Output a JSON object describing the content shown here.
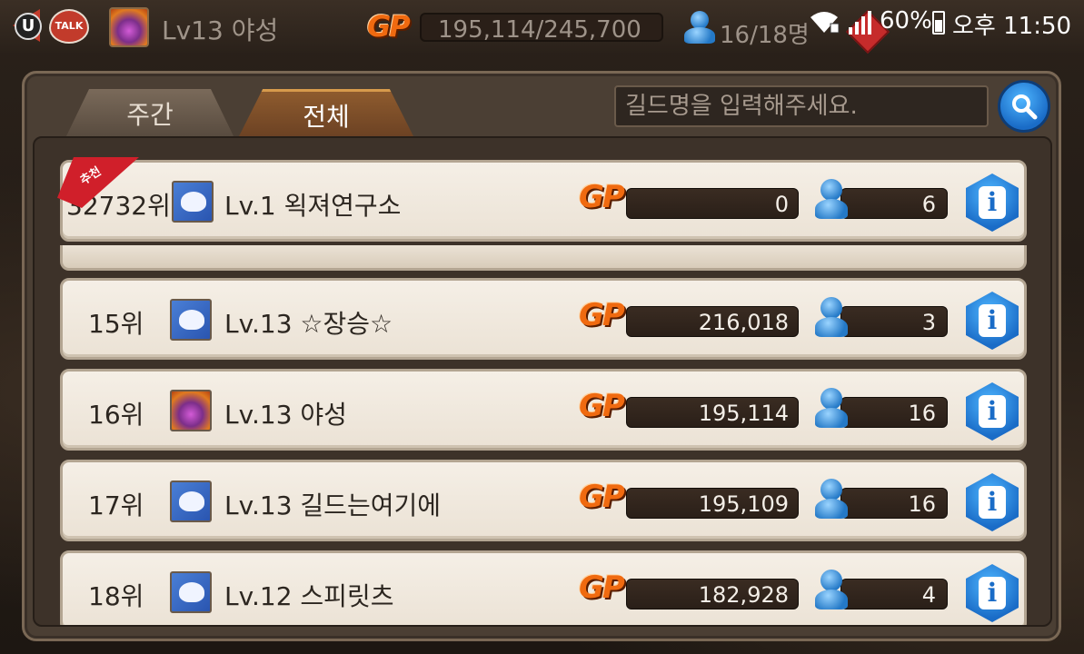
{
  "topbar": {
    "app_icon_label": "U",
    "talk_label": "TALK",
    "guild_title": "Lv13 야성",
    "gp_label": "GP",
    "gp_value": "195,114/245,700",
    "members_value": "16/18명"
  },
  "status_bar": {
    "battery_pct": "60%",
    "time": "오후 11:50"
  },
  "tabs": [
    {
      "label": "주간",
      "active": false
    },
    {
      "label": "전체",
      "active": true
    }
  ],
  "search": {
    "placeholder": "길드명을 입력해주세요."
  },
  "featured_row": {
    "badge": "추천",
    "rank": "32732위",
    "name": "Lv.1   왹져연구소",
    "gp_label": "GP",
    "gp": "0",
    "members": "6",
    "info_label": "i"
  },
  "rows": [
    {
      "rank": "15위",
      "name": "Lv.13 ☆장승☆",
      "gp_label": "GP",
      "gp": "216,018",
      "members": "3",
      "info_label": "i"
    },
    {
      "rank": "16위",
      "name": "Lv.13 야성",
      "gp_label": "GP",
      "gp": "195,114",
      "members": "16",
      "info_label": "i"
    },
    {
      "rank": "17위",
      "name": "Lv.13 길드는여기에",
      "gp_label": "GP",
      "gp": "195,109",
      "members": "16",
      "info_label": "i"
    },
    {
      "rank": "18위",
      "name": "Lv.12 스피릿츠",
      "gp_label": "GP",
      "gp": "182,928",
      "members": "4",
      "info_label": "i"
    }
  ],
  "colors": {
    "gp_orange": "#f06a10",
    "info_blue": "#1a6cc7",
    "ribbon_red": "#d01f2a"
  }
}
